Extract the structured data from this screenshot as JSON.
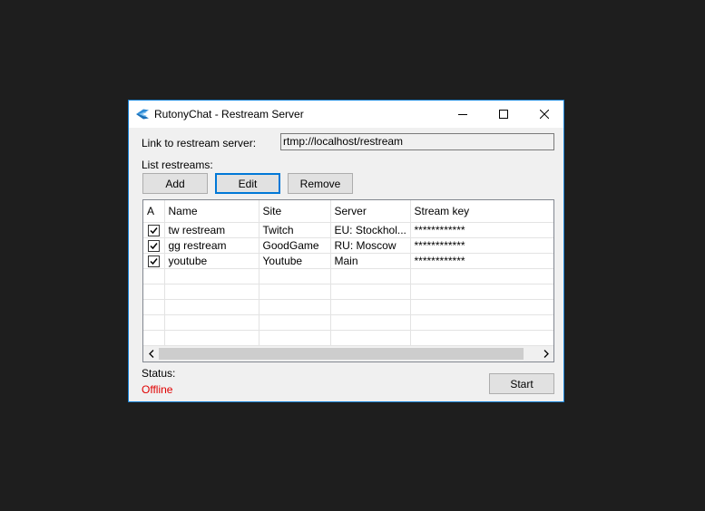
{
  "window": {
    "title": "RutonyChat - Restream Server"
  },
  "link": {
    "label": "Link to restream server:",
    "value": "rtmp://localhost/restream"
  },
  "list": {
    "label": "List restreams:",
    "buttons": {
      "add": "Add",
      "edit": "Edit",
      "remove": "Remove"
    },
    "columns": [
      "A",
      "Name",
      "Site",
      "Server",
      "Stream key"
    ],
    "rows": [
      {
        "active": true,
        "name": "tw restream",
        "site": "Twitch",
        "server": "EU: Stockhol...",
        "key": "************"
      },
      {
        "active": true,
        "name": "gg restream",
        "site": "GoodGame",
        "server": "RU: Moscow",
        "key": "************"
      },
      {
        "active": true,
        "name": "youtube",
        "site": "Youtube",
        "server": "Main",
        "key": "************"
      }
    ]
  },
  "status": {
    "label": "Status:",
    "value": "Offline",
    "color": "#e00000"
  },
  "start_button": "Start",
  "icons": {
    "app": "rutonychat-logo-icon",
    "minimize": "minimize-icon",
    "maximize": "maximize-icon",
    "close": "close-icon"
  }
}
